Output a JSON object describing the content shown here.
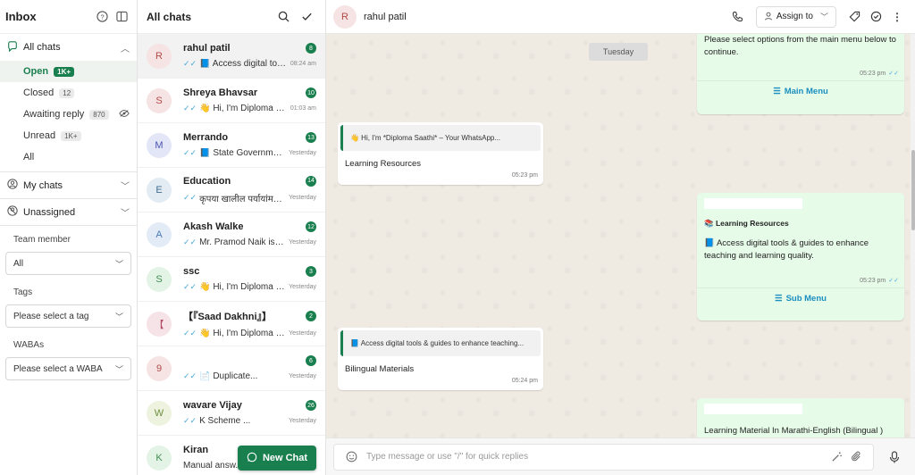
{
  "inbox": {
    "title": "Inbox",
    "all_chats": {
      "label": "All chats"
    },
    "status_items": [
      {
        "label": "Open",
        "count": "1K+"
      },
      {
        "label": "Closed",
        "count": "12"
      },
      {
        "label": "Awaiting reply",
        "count": "870"
      },
      {
        "label": "Unread",
        "count": "1K+"
      },
      {
        "label": "All",
        "count": ""
      }
    ],
    "my_chats": "My chats",
    "unassigned": "Unassigned",
    "team_member_label": "Team member",
    "team_member_value": "All",
    "tags_label": "Tags",
    "tags_value": "Please select a tag",
    "wabas_label": "WABAs",
    "wabas_value": "Please select a WABA"
  },
  "chatlist": {
    "title": "All chats",
    "new_chat_label": "New Chat",
    "items": [
      {
        "initial": "R",
        "name": "rahul patil",
        "badge": "8",
        "preview": "📘 Access digital too...",
        "time": "08:24 am",
        "ticks": "✓✓",
        "avatar_bg": "#f6e3e3",
        "avatar_fg": "#b24b4b"
      },
      {
        "initial": "S",
        "name": "Shreya Bhavsar",
        "badge": "10",
        "preview": "👋 Hi, I'm Diploma S...",
        "time": "01:03 am",
        "ticks": "✓✓",
        "avatar_bg": "#f6e3e3",
        "avatar_fg": "#b24b4b"
      },
      {
        "initial": "M",
        "name": "Merrando",
        "badge": "13",
        "preview": "📘 State Governmen...",
        "time": "Yesterday",
        "ticks": "✓✓",
        "avatar_bg": "#e3e6f6",
        "avatar_fg": "#4b55b2"
      },
      {
        "initial": "E",
        "name": "Education",
        "badge": "14",
        "preview": "कृपया खालील पर्यायांमधून...",
        "time": "Yesterday",
        "ticks": "✓✓",
        "avatar_bg": "#e3ecf3",
        "avatar_fg": "#3f6d8f"
      },
      {
        "initial": "A",
        "name": "Akash Walke",
        "badge": "12",
        "preview": "Mr. Pramod Naik is t...",
        "time": "Yesterday",
        "ticks": "✓✓",
        "avatar_bg": "#e3ecf6",
        "avatar_fg": "#4b79b2"
      },
      {
        "initial": "S",
        "name": "ssc",
        "badge": "3",
        "preview": "👋 Hi, I'm Diploma S...",
        "time": "Yesterday",
        "ticks": "✓✓",
        "avatar_bg": "#e3f3e6",
        "avatar_fg": "#3f8f52"
      },
      {
        "initial": "【",
        "name": "【『Saad Dakhni』】",
        "badge": "2",
        "preview": "👋 Hi, I'm Diploma S...",
        "time": "Yesterday",
        "ticks": "✓✓",
        "avatar_bg": "#f6e3e8",
        "avatar_fg": "#b24b63"
      },
      {
        "initial": "9",
        "name": "",
        "badge": "6",
        "preview": "📄 Duplicate...",
        "time": "Yesterday",
        "ticks": "✓✓",
        "avatar_bg": "#f6e3e3",
        "avatar_fg": "#b24b4b"
      },
      {
        "initial": "W",
        "name": "wavare Vijay",
        "badge": "26",
        "preview": "K Scheme ...",
        "time": "Yesterday",
        "ticks": "✓✓",
        "avatar_bg": "#eef3e0",
        "avatar_fg": "#6f8f3f"
      },
      {
        "initial": "K",
        "name": "Kiran",
        "badge": "",
        "preview": "Manual answ...",
        "time": "",
        "ticks": "",
        "avatar_bg": "#e3f3e6",
        "avatar_fg": "#3f8f52"
      }
    ]
  },
  "conversation": {
    "contact_initial": "R",
    "contact_name": "rahul patil",
    "assign_label": "Assign to",
    "day_label": "Tuesday",
    "messages": {
      "m1_text": "Please select options from the main menu below to continue.",
      "m1_time": "05:23 pm",
      "m1_button": "Main Menu",
      "m2_quote": "👋 Hi, I'm *Diploma Saathi* – Your            WhatsApp...",
      "m2_text": "Learning Resources",
      "m2_time": "05:23 pm",
      "m3_heading": "📚 Learning Resources",
      "m3_text": "📘 Access digital tools & guides to enhance teaching and learning quality.",
      "m3_time": "05:23 pm",
      "m3_button": "Sub Menu",
      "m4_quote": "📘 Access digital tools & guides to enhance teaching...",
      "m4_text": "Bilingual Materials",
      "m4_time": "05:24 pm",
      "m5_text": "Learning Material In Marathi-English (Bilingual )"
    },
    "composer_placeholder": "Type message or use \"/\" for quick replies"
  },
  "colors": {
    "brand_green": "#1a7f4e",
    "link_blue": "#1a8fc0",
    "tick_blue": "#4aa8d8",
    "chat_bg": "#efeae2",
    "out_bubble": "#e7fbe9"
  }
}
